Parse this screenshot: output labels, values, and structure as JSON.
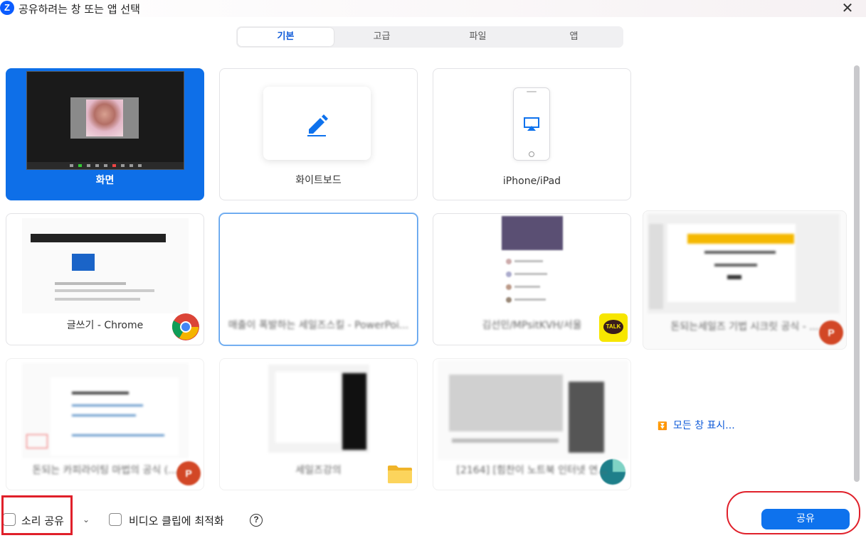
{
  "window": {
    "title": "공유하려는 창 또는 앱 선택",
    "logo_letter": "Z"
  },
  "tabs": [
    {
      "label": "기본",
      "active": true
    },
    {
      "label": "고급"
    },
    {
      "label": "파일"
    },
    {
      "label": "앱"
    }
  ],
  "cards": [
    {
      "label": "화면",
      "selected": true
    },
    {
      "label": "화이트보드"
    },
    {
      "label": "iPhone/iPad"
    },
    {
      "label": "글쓰기 - Chrome"
    },
    {
      "label": "매출이 폭발하는 세일즈스킬 - PowerPoi..."
    },
    {
      "label": "김선민/MPsitKVH/서울",
      "badge_text": "TALK"
    },
    {
      "label": "돈되는세일즈 기법 시크릿 공식 - ...",
      "badge_text": "P"
    },
    {
      "label": "돈되는 카피라이팅 마법의 공식 (...",
      "badge_text": "P"
    },
    {
      "label": "세일즈강의"
    },
    {
      "label": "[2164] [힘찬이 노트북 인터넷 연..."
    }
  ],
  "show_all": "모든 창 표시...",
  "bottom": {
    "share_sound": "소리 공유",
    "optimize_video": "비디오 클립에 최적화",
    "help": "?",
    "share_button": "공유"
  },
  "colors": {
    "accent": "#0e72ed",
    "selected_card": "#0e6fe8",
    "highlight": "#e0202a"
  }
}
